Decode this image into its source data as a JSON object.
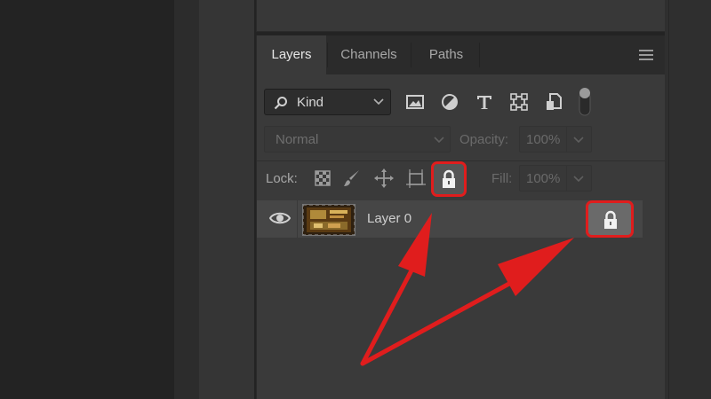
{
  "tabs": [
    {
      "label": "Layers",
      "active": true
    },
    {
      "label": "Channels",
      "active": false
    },
    {
      "label": "Paths",
      "active": false
    }
  ],
  "filter": {
    "kind_label": "Kind",
    "icons": [
      "image-filter-icon",
      "adjustment-filter-icon",
      "type-filter-icon",
      "shape-filter-icon",
      "smart-object-filter-icon",
      "filter-toggle-icon"
    ]
  },
  "blend": {
    "mode": "Normal",
    "opacity_label": "Opacity:",
    "opacity_value": "100%"
  },
  "lock": {
    "label": "Lock:",
    "icons": [
      "lock-transparent-pixels-icon",
      "lock-image-pixels-icon",
      "lock-position-icon",
      "lock-artboard-icon",
      "lock-all-icon"
    ],
    "fill_label": "Fill:",
    "fill_value": "100%"
  },
  "layers": [
    {
      "name": "Layer 0",
      "visible": true,
      "locked": true
    }
  ],
  "colors": {
    "highlight": "#e01d1d",
    "panel": "#3a3a3a",
    "selected_row": "#464646"
  }
}
